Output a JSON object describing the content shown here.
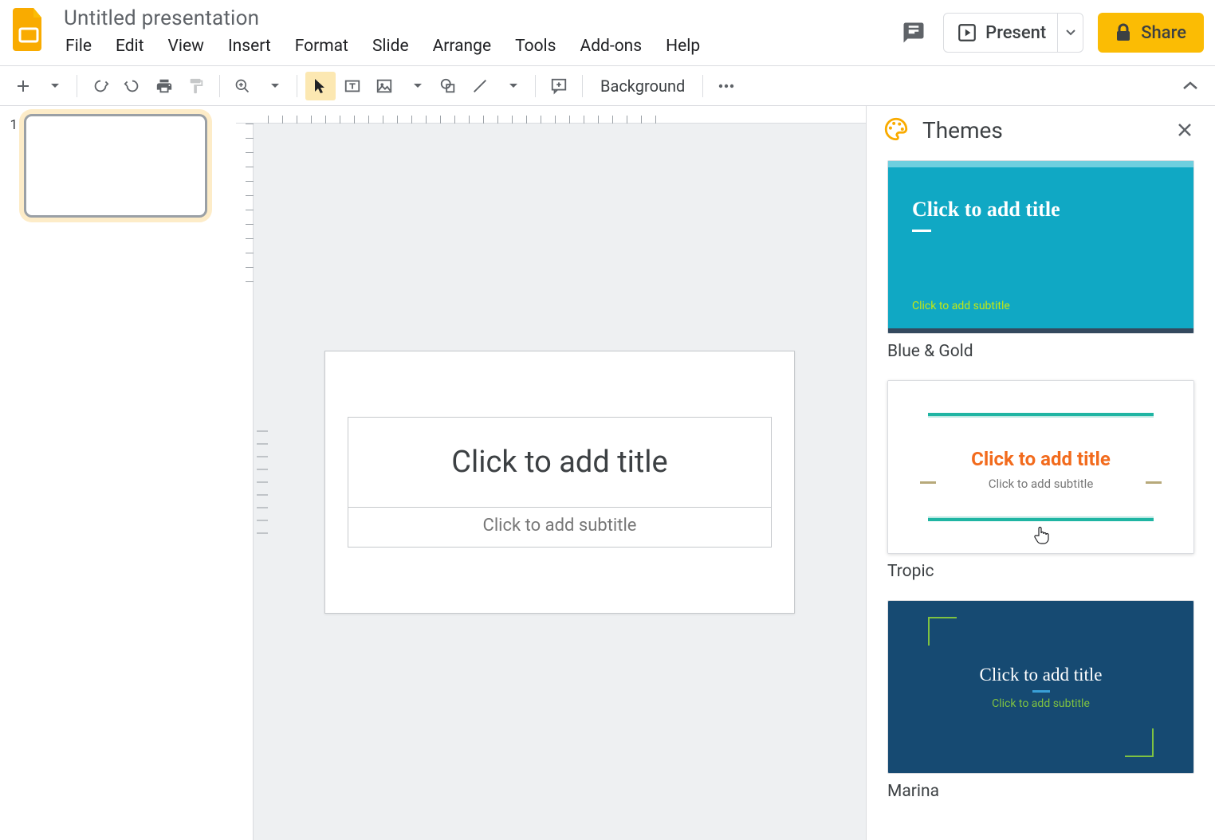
{
  "doc": {
    "title": "Untitled presentation"
  },
  "menus": [
    "File",
    "Edit",
    "View",
    "Insert",
    "Format",
    "Slide",
    "Arrange",
    "Tools",
    "Add-ons",
    "Help"
  ],
  "header": {
    "present": "Present",
    "share": "Share"
  },
  "toolbar": {
    "background": "Background"
  },
  "filmstrip": {
    "slides": [
      {
        "index": "1"
      }
    ]
  },
  "canvas": {
    "title_placeholder": "Click to add title",
    "subtitle_placeholder": "Click to add subtitle"
  },
  "themes_panel": {
    "title": "Themes",
    "items": [
      {
        "name": "Blue & Gold",
        "preview_title": "Click to add title",
        "preview_subtitle": "Click to add subtitle"
      },
      {
        "name": "Tropic",
        "preview_title": "Click to add title",
        "preview_subtitle": "Click to add subtitle"
      },
      {
        "name": "Marina",
        "preview_title": "Click to add title",
        "preview_subtitle": "Click to add subtitle"
      }
    ]
  }
}
